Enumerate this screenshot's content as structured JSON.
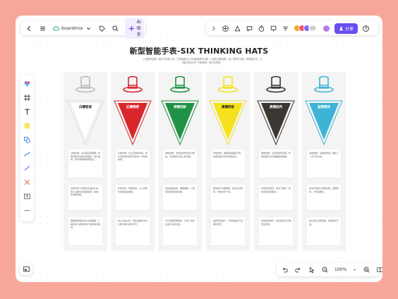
{
  "app": {
    "name": "boardmix",
    "ai_label": "AI助手",
    "share_label": "分享",
    "zoom": "100%",
    "avatar_more": "+5"
  },
  "board": {
    "title": "新型智能手表-SIX THINKING HATS",
    "subtitle": "六顶思考帽是一种平行思维工具，它帮助我们从不同角度思考问题，以提高决策效率。每一顶帽子代表一种思维方式，让团队成员在同一时间用同一种方式思考。"
  },
  "hats": [
    {
      "label": "白帽客观",
      "color": "#c8c8c8",
      "text_color": "#222",
      "cards": [
        "白帽思维：关注事实和数据。新型智能手表的市场规模、用户需求、技术参数等客观信息。",
        "目前市场上智能手表品牌众多，用户主要关注健康监测、续航、外观等功能。",
        "需要收集更多用户反馈数据，了解目标人群的使用习惯和购买偏好。"
      ]
    },
    {
      "label": "红帽情感",
      "color": "#d9262b",
      "text_color": "#fff",
      "cards": [
        "红帽思维：表达直觉和情感。用户对新型智能手表的第一印象和感受。",
        "外观时尚，佩戴舒适，让人感到科技感和品质感。",
        "担心价格过高，隐私数据安全也让部分用户感到不安。"
      ]
    },
    {
      "label": "绿帽创新",
      "color": "#1f9246",
      "text_color": "#fff",
      "cards": [
        "绿帽思维：寻找新的想法和可能性。为智能手表加入新功能。",
        "增加情绪监测、睡眠辅助、AI语音助手等创新功能。",
        "可与智能家居联动，打造个性化表盘与运动社区。"
      ]
    },
    {
      "label": "黄帽积极",
      "color": "#f5e21c",
      "text_color": "#222",
      "cards": [
        "黄帽思维：看到积极面和价值。新型智能手表带来的好处。",
        "帮助用户管理健康，提高生活效率，市场前景广阔。",
        "品牌形象提升，可带动相关产品销售增长。"
      ]
    },
    {
      "label": "黑帽批判",
      "color": "#3b3631",
      "text_color": "#fff",
      "cards": [
        "黑帽思维：识别风险和问题。新型智能手表可能面临的困难。",
        "市场竞争激烈，技术门槛高，续航问题仍待解决。",
        "研发成本较高，供应链存在不确定性风险。"
      ]
    },
    {
      "label": "蓝帽管控",
      "color": "#3fb3d6",
      "text_color": "#fff",
      "cards": [
        "蓝帽思维：总结和规划。确定下一步行动方向。",
        "优先开发核心健康功能，控制成本，分阶段推出。",
        "建立用户反馈机制，持续迭代产品。"
      ]
    }
  ],
  "icons": {
    "back": "chevron-left-icon",
    "menu": "menu-icon",
    "tag": "tag-icon",
    "search": "search-icon",
    "help": "help-icon",
    "undo": "undo-icon",
    "redo": "redo-icon"
  }
}
